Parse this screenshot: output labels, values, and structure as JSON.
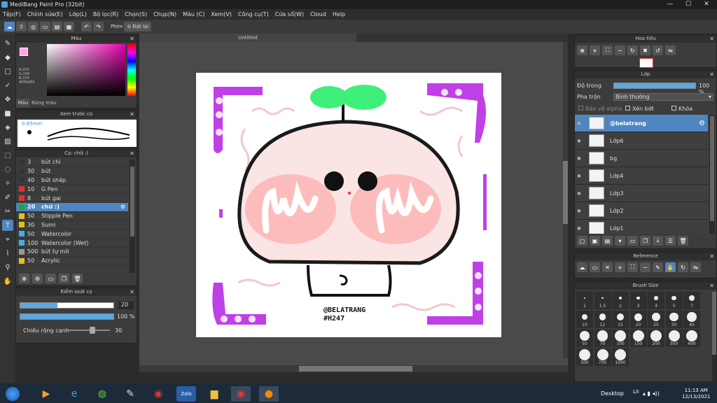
{
  "window": {
    "title": "MediBang Paint Pro (32bit)",
    "minimize": "—",
    "maximize": "☐",
    "close": "✕"
  },
  "menu": [
    "Tệp(F)",
    "Chỉnh sửa(E)",
    "Lớp(L)",
    "Bộ lọc(R)",
    "Chọn(S)",
    "Chụp(N)",
    "Màu (C)",
    "Xem(V)",
    "Công cụ(T)",
    "Cửa sổ(W)",
    "Cloud",
    "Help"
  ],
  "toolbar": {
    "phim_label": "Phím",
    "reset_label": "Đặt lại"
  },
  "color_panel": {
    "title": "Màu",
    "r": "R:255",
    "g": "G:164",
    "b": "B:229",
    "hex": "#FFA4E5",
    "tab_color": "Màu",
    "tab_palette": "Bảng màu",
    "accent": "#ffa4e5"
  },
  "preview_panel": {
    "title": "Xem trước cọ",
    "size": "0.85mm"
  },
  "brush_panel": {
    "title": "Cọ: chữ :)",
    "items": [
      {
        "size": "3",
        "name": "bút chì",
        "color": "#333333"
      },
      {
        "size": "30",
        "name": "bút",
        "color": "#333333"
      },
      {
        "size": "40",
        "name": "bút sháp",
        "color": "#333333"
      },
      {
        "size": "10",
        "name": "G Pen",
        "color": "#e03030"
      },
      {
        "size": "8",
        "name": "bút gai",
        "color": "#e03030"
      },
      {
        "size": "20",
        "name": "chữ :)",
        "color": "#22aa22"
      },
      {
        "size": "50",
        "name": "Stipple Pen",
        "color": "#e0c020"
      },
      {
        "size": "30",
        "name": "Sumi",
        "color": "#e0c020"
      },
      {
        "size": "50",
        "name": "Watercolor",
        "color": "#40b0e0"
      },
      {
        "size": "100",
        "name": "Watercolor (Wet)",
        "color": "#40b0e0"
      },
      {
        "size": "500",
        "name": "bút tự mờ",
        "color": "#999999"
      },
      {
        "size": "50",
        "name": "Acrylic",
        "color": "#e0c020"
      }
    ]
  },
  "brush_control": {
    "title": "Kiểm soát cọ",
    "size_value": "20",
    "opacity_value": "100 %",
    "edge_label": "Chiều rộng cạnh",
    "edge_value": "30",
    "size_fraction": 0.4,
    "opacity_fraction": 1.0,
    "edge_fraction": 0.6
  },
  "canvas": {
    "title": "Untitled",
    "credit_line1": "@BELATRANG",
    "credit_line2": "#H247"
  },
  "navigator": {
    "title": "Hoa tiêu"
  },
  "layer_panel": {
    "title": "Lớp",
    "opacity_label": "Độ trong",
    "opacity_value": "100 %",
    "blend_label": "Pha trộn",
    "blend_value": "Bình thường",
    "protect_alpha": "Bảo vệ alpha",
    "clipping": "Xén bớt",
    "lock": "Khóa",
    "layers": [
      "@belatrang",
      "Lớp6",
      "bg",
      "Lớp4",
      "Lớp3",
      "Lớp2",
      "Lớp1"
    ]
  },
  "reference_panel": {
    "title": "Reference"
  },
  "brush_size_panel": {
    "title": "Brush Size",
    "sizes": [
      "1",
      "1.5",
      "2",
      "3",
      "4",
      "5",
      "7",
      "10",
      "12",
      "15",
      "20",
      "25",
      "30",
      "40",
      "50",
      "70",
      "100",
      "150",
      "200",
      "300",
      "400",
      "500",
      "700",
      "1000"
    ]
  },
  "taskbar": {
    "desktop": "Desktop",
    "lang": "Lit",
    "time": "11:13 AM",
    "date": "12/13/2021",
    "zalo": "Zalo"
  }
}
